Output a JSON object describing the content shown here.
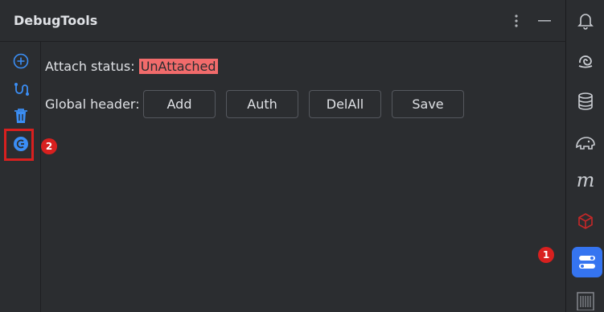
{
  "panel": {
    "title": "DebugTools"
  },
  "content": {
    "attach_status_label": "Attach status:",
    "attach_status_value": "UnAttached",
    "global_header_label": "Global header:",
    "buttons": {
      "add": "Add",
      "auth": "Auth",
      "del_all": "DelAll",
      "save": "Save"
    }
  },
  "annotations": {
    "badge_1": "1",
    "badge_2": "2"
  },
  "left_toolbar_icons": [
    "add-circle-icon",
    "route-icon",
    "trash-icon",
    "ghost-icon"
  ],
  "right_toolbar_icons": [
    "bell-icon",
    "swirl-icon",
    "database-icon",
    "elephant-icon",
    "m-icon",
    "cube-icon",
    "debug-tools-icon",
    "barcode-icon"
  ],
  "colors": {
    "accent": "#3574f0",
    "status_bg": "#f16b6b",
    "annotation_red": "#d8201f"
  }
}
